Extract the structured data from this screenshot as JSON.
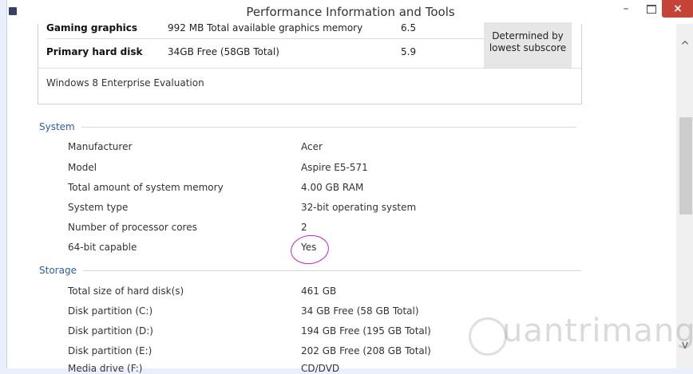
{
  "window": {
    "title": "Performance Information and Tools",
    "controls": {
      "minimize": "–",
      "maximize": "□",
      "close": "×"
    }
  },
  "score_table": {
    "rows": [
      {
        "label": "Gaming graphics",
        "description": "992 MB Total available graphics memory",
        "score": "6.5"
      },
      {
        "label": "Primary hard disk",
        "description": "34GB Free (58GB Total)",
        "score": "5.9"
      }
    ],
    "subscore_note": "Determined by lowest subscore",
    "edition": "Windows 8 Enterprise Evaluation"
  },
  "system": {
    "header": "System",
    "items": [
      {
        "label": "Manufacturer",
        "value": "Acer"
      },
      {
        "label": "Model",
        "value": "Aspire E5-571"
      },
      {
        "label": "Total amount of system memory",
        "value": "4.00 GB RAM"
      },
      {
        "label": "System type",
        "value": "32-bit operating system"
      },
      {
        "label": "Number of processor cores",
        "value": "2"
      },
      {
        "label": "64-bit capable",
        "value": "Yes"
      }
    ]
  },
  "storage": {
    "header": "Storage",
    "items": [
      {
        "label": "Total size of hard disk(s)",
        "value": "461 GB"
      },
      {
        "label": "Disk partition (C:)",
        "value": "34 GB Free (58 GB Total)"
      },
      {
        "label": "Disk partition (D:)",
        "value": "194 GB Free (195 GB Total)"
      },
      {
        "label": "Disk partition (E:)",
        "value": "202 GB Free (208 GB Total)"
      },
      {
        "label": "Media drive (F:)",
        "value": "CD/DVD"
      }
    ]
  },
  "watermark": "uantrimang",
  "icons": {
    "scroll_up": "chevron-up-icon",
    "scroll_down": "chevron-down-icon",
    "app": "app-icon"
  }
}
